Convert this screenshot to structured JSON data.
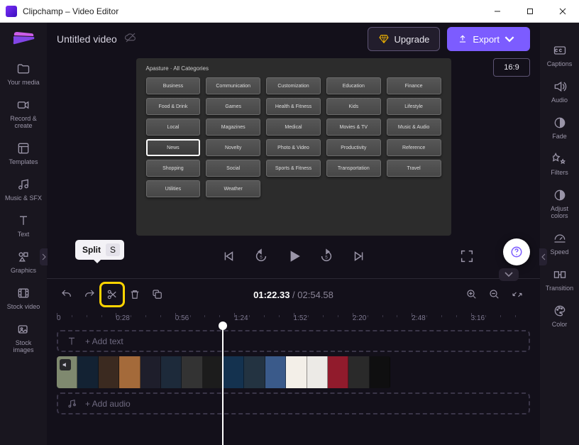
{
  "window": {
    "title": "Clipchamp – Video Editor"
  },
  "header": {
    "project_name": "Untitled video",
    "upgrade_label": "Upgrade",
    "export_label": "Export",
    "aspect_label": "16:9"
  },
  "left_sidebar": {
    "items": [
      {
        "label": "Your media"
      },
      {
        "label": "Record &\ncreate"
      },
      {
        "label": "Templates"
      },
      {
        "label": "Music & SFX"
      },
      {
        "label": "Text"
      },
      {
        "label": "Graphics"
      },
      {
        "label": "Stock video"
      },
      {
        "label": "Stock\nimages"
      }
    ]
  },
  "right_sidebar": {
    "items": [
      {
        "label": "Captions"
      },
      {
        "label": "Audio"
      },
      {
        "label": "Fade"
      },
      {
        "label": "Filters"
      },
      {
        "label": "Adjust\ncolors"
      },
      {
        "label": "Speed"
      },
      {
        "label": "Transition"
      },
      {
        "label": "Color"
      }
    ]
  },
  "preview": {
    "heading": "Apasture · All Categories",
    "selected": "News",
    "categories": [
      "Business",
      "Communication",
      "Customization",
      "Education",
      "Finance",
      "Food & Drink",
      "Games",
      "Health & Fitness",
      "Kids",
      "Lifestyle",
      "Local",
      "Magazines",
      "Medical",
      "Movies & TV",
      "Music & Audio",
      "News",
      "Novelty",
      "Photo & Video",
      "Productivity",
      "Reference",
      "Shopping",
      "Social",
      "Sports & Fitness",
      "Transportation",
      "Travel",
      "Utilities",
      "Weather"
    ]
  },
  "tooltip": {
    "label": "Split",
    "key": "S"
  },
  "timecode": {
    "current": "01:22.33",
    "total": "02:54.58",
    "sep": " / "
  },
  "ruler": {
    "ticks": [
      "0",
      "0:28",
      "0:56",
      "1:24",
      "1:52",
      "2:20",
      "2:48",
      "3:16"
    ]
  },
  "tracks": {
    "add_text": "+ Add text",
    "add_audio": "+ Add audio"
  },
  "video_clip": {
    "thumb_colors": [
      "#7f896f",
      "#132233",
      "#3b2a20",
      "#a46a3a",
      "#1e1e2b",
      "#1d2a3a",
      "#333",
      "#1c1c1c",
      "#14324f",
      "#233341",
      "#3a5a8a",
      "#f3efe8",
      "#eceae6",
      "#911b2c",
      "#2a2a2a",
      "#0f0f10"
    ]
  }
}
